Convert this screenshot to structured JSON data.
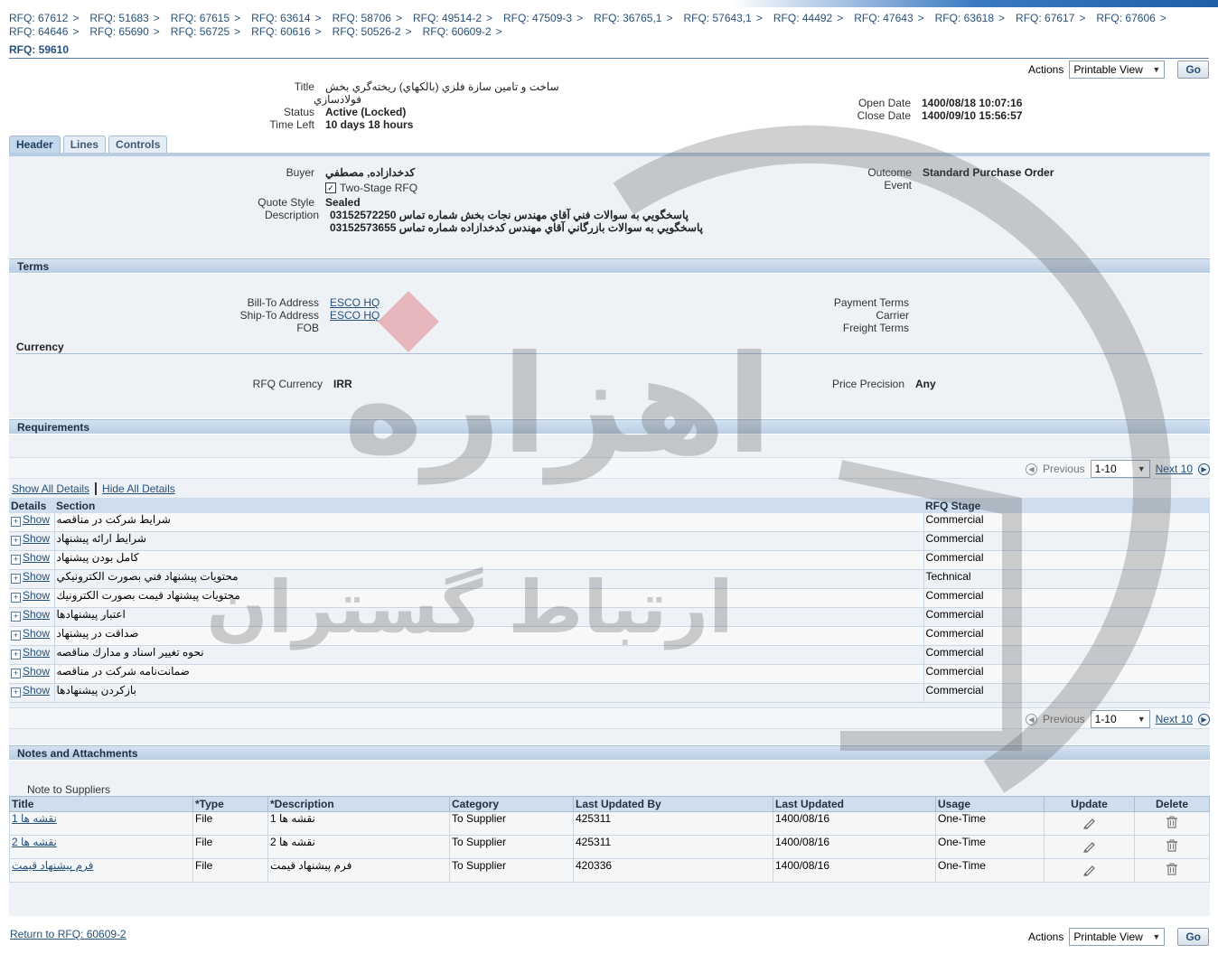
{
  "breadcrumbs": [
    "RFQ: 67612",
    "RFQ: 51683",
    "RFQ: 67615",
    "RFQ: 63614",
    "RFQ: 58706",
    "RFQ: 49514-2",
    "RFQ: 47509-3",
    "RFQ: 36765,1",
    "RFQ: 57643,1",
    "RFQ: 44492",
    "RFQ: 47643",
    "RFQ: 63618",
    "RFQ: 67617",
    "RFQ: 67606",
    "RFQ: 64646",
    "RFQ: 65690",
    "RFQ: 56725",
    "RFQ: 60616",
    "RFQ: 50526-2",
    "RFQ: 60609-2"
  ],
  "page_title": "RFQ: 59610",
  "actions": {
    "label": "Actions",
    "selected": "Printable View",
    "go": "Go"
  },
  "summary": {
    "title_label": "Title",
    "title_line1": "ساخت و تامين سازة فلزي (بالكهاي) ريخته‌گري بخش",
    "title_line2": "فولادسازي",
    "status_label": "Status",
    "status_value": "Active (Locked)",
    "time_left_label": "Time Left",
    "time_left_value": "10 days 18 hours",
    "open_date_label": "Open Date",
    "open_date_value": "1400/08/18 10:07:16",
    "close_date_label": "Close Date",
    "close_date_value": "1400/09/10 15:56:57"
  },
  "tabs": [
    "Header",
    "Lines",
    "Controls"
  ],
  "header": {
    "buyer_label": "Buyer",
    "buyer_value": "كدخدازاده, مصطفي",
    "two_stage": "Two-Stage RFQ",
    "quote_style_label": "Quote Style",
    "quote_style_value": "Sealed",
    "description_label": "Description",
    "description_line1": "پاسخگويي به سوالات فني آقاي مهندس نجات بخش شماره تماس 03152572250",
    "description_line2": "پاسخگويي به سوالات بازرگاني آقاي مهندس كدخدازاده شماره تماس 03152573655",
    "outcome_label": "Outcome",
    "outcome_value": "Standard Purchase Order",
    "event_label": "Event"
  },
  "terms": {
    "heading": "Terms",
    "bill_to_label": "Bill-To Address",
    "bill_to_value": "ESCO HQ",
    "ship_to_label": "Ship-To Address",
    "ship_to_value": "ESCO HQ",
    "fob_label": "FOB",
    "payment_terms_label": "Payment Terms",
    "carrier_label": "Carrier",
    "freight_terms_label": "Freight Terms",
    "currency_heading": "Currency",
    "rfq_currency_label": "RFQ Currency",
    "rfq_currency_value": "IRR",
    "price_precision_label": "Price Precision",
    "price_precision_value": "Any"
  },
  "requirements": {
    "heading": "Requirements",
    "previous": "Previous",
    "range": "1-10",
    "next": "Next 10",
    "show_all": "Show All Details",
    "hide_all": "Hide All Details",
    "columns": {
      "details": "Details",
      "section": "Section",
      "stage": "RFQ Stage"
    },
    "show_label": "Show",
    "rows": [
      {
        "section": "شرايط شركت در مناقصه",
        "stage": "Commercial"
      },
      {
        "section": "شرايط ارائه پيشنهاد",
        "stage": "Commercial"
      },
      {
        "section": "كامل بودن پيشنهاد",
        "stage": "Commercial"
      },
      {
        "section": "محتويات پيشنهاد فني بصورت الكترونيكي",
        "stage": "Technical"
      },
      {
        "section": "محتويات پيشنهاد قيمت بصورت الكترونيك",
        "stage": "Commercial"
      },
      {
        "section": "اعتبار پيشنهادها",
        "stage": "Commercial"
      },
      {
        "section": "صداقت در پيشنهاد",
        "stage": "Commercial"
      },
      {
        "section": "نحوه تغيير اسناد و مدارك مناقصه",
        "stage": "Commercial"
      },
      {
        "section": "ضمانت‌نامه شركت در مناقصه",
        "stage": "Commercial"
      },
      {
        "section": "بازكردن پيشنهادها",
        "stage": "Commercial"
      }
    ]
  },
  "notes": {
    "heading": "Notes and Attachments",
    "note_to_suppliers": "Note to Suppliers",
    "columns": {
      "title": "Title",
      "type": "*Type",
      "description": "*Description",
      "category": "Category",
      "last_updated_by": "Last Updated By",
      "last_updated": "Last Updated",
      "usage": "Usage",
      "update": "Update",
      "delete": "Delete"
    },
    "rows": [
      {
        "title": "نقشه ها 1",
        "type": "File",
        "description": "نقشه ها 1",
        "category": "To Supplier",
        "by": "425311",
        "date": "1400/08/16",
        "usage": "One-Time"
      },
      {
        "title": "نقشه ها 2",
        "type": "File",
        "description": "نقشه ها 2",
        "category": "To Supplier",
        "by": "425311",
        "date": "1400/08/16",
        "usage": "One-Time"
      },
      {
        "title": "فرم پيشنهاد قيمت",
        "type": "File",
        "description": "فرم پيشنهاد قيمت",
        "category": "To Supplier",
        "by": "420336",
        "date": "1400/08/16",
        "usage": "One-Time"
      }
    ]
  },
  "footer": {
    "return_link": "Return to RFQ: 60609-2"
  },
  "watermark": {
    "brand_text_1": "اهزاره",
    "brand_text_2": "ارتباط گستران"
  }
}
